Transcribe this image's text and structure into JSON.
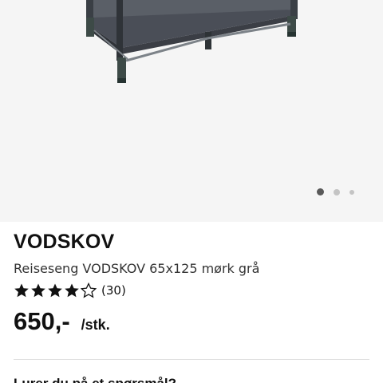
{
  "gallery": {
    "image_alt": "Reiseseng VODSKOV 65x125 mørk grå",
    "slide_count": 3,
    "active_slide": 1
  },
  "product": {
    "name": "VODSKOV",
    "description": "Reiseseng VODSKOV 65x125 mørk grå",
    "rating": {
      "stars": 4,
      "max_stars": 5,
      "count_text": "(30)"
    },
    "price": {
      "value": "650,-",
      "unit": "/stk."
    },
    "cutoff_text": "Lurer du på et spørsmål?"
  },
  "colors": {
    "star": "#111111",
    "active_dot": "#595959",
    "inactive_dot": "#c4c4c4",
    "gallery_background": "#f5f5f5"
  }
}
